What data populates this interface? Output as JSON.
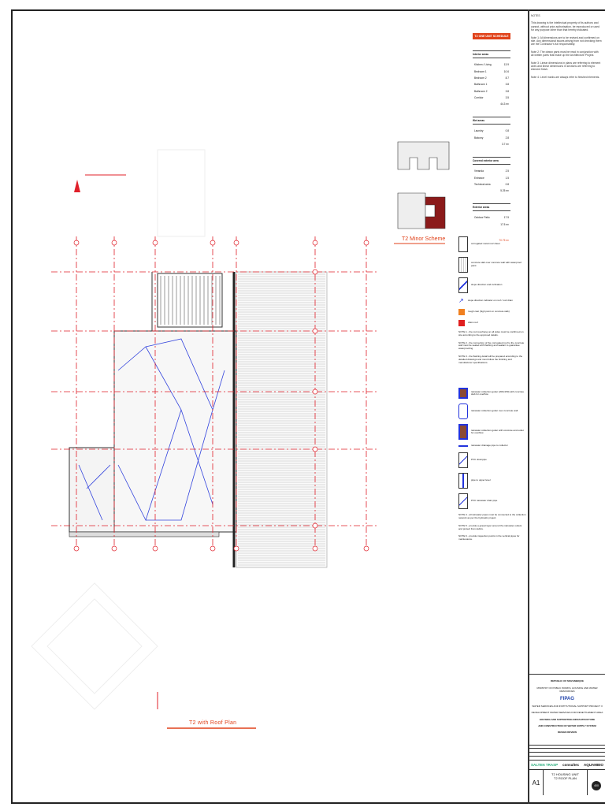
{
  "notes": {
    "heading": "NOTES",
    "items": [
      "This drawing is the intellectual property of its authors and cannot, without prior authorisation, be reproduced or used for any purpose other than that hereby indicated.",
      "Note 1: All dimensions are to be revised and confirmed on site. Any dimensional issues arising from not checking them are the Contractor's full responsibility.",
      "Note 2: The drawn parts must be read in conjunction with all written parts that make up the Architecture Project.",
      "Note 3: Linear dimensions in plans are referring to element axes and linear dimensions in sections are referring to element finish.",
      "Note 4: Level marks are always refer to finished elements."
    ]
  },
  "schedule": {
    "title": "T2 ONE UNIT SCHEDULE",
    "groups": [
      {
        "title": "Interior areas",
        "rows": [
          [
            "Kitchen / Living",
            "13.9"
          ],
          [
            "Bedroom 1",
            "10.6"
          ],
          [
            "Bedroom 2",
            "8.7"
          ],
          [
            "Bathroom 1",
            "3.8"
          ],
          [
            "Bathroom 2",
            "3.8"
          ],
          [
            "Corridor",
            "3.5"
          ]
        ],
        "total": "44.3 m²"
      },
      {
        "title": "Wet areas",
        "rows": [
          [
            "Laundry",
            "0.8"
          ],
          [
            "Balcony",
            "2.8"
          ]
        ],
        "total": "3.7 m²"
      },
      {
        "title": "Covered exterior area",
        "rows": [
          [
            "Veranda",
            "2.5"
          ],
          [
            "Entrance",
            "1.5"
          ],
          [
            "Technical area",
            "0.8"
          ]
        ],
        "total": "5.25 m²"
      },
      {
        "title": "Exterior areas",
        "rows": [
          [
            "Outdoor Patio",
            "17.5"
          ]
        ],
        "total": "17.5 m²"
      }
    ],
    "grand_total": "70.75 m²"
  },
  "minor_scheme_title": "T2 Minor Scheme",
  "plan_title": "T2 with Roof Plan",
  "legend": {
    "items": [
      "corrugated metal roof sheet",
      "concrete slab over concrete wall with waterproof paint",
      "slope direction and inclination",
      "slope direction indicator on roof / roof drain",
      "rough cast (high point on concrete slab)",
      "drain roof"
    ],
    "paras": [
      "NOTE 1 - the roof overhang on all sides must be confirmed on site according to the approved details.",
      "NOTE 2 - the connection of the corrugated roof to the concrete wall must be sealed with flashing and sealant to guarantee waterproofing.",
      "NOTE 3 - the flashing detail will be prepared according to the detailed drawings and must follow the finishing and manufacturer specifications."
    ],
    "items2": [
      "rainwater collection gutter (200x150) with concrete slab for overflow",
      "rainwater collection gutter over concrete wall",
      "rainwater collection gutter with concrete and outlet for overflow",
      "rainwater drainage pipe to collector",
      "PVC downpipe",
      "pipe to upper level",
      "PVC rainwater drain pipe"
    ],
    "paras2": [
      "NOTE 4 - all rainwater pipes must be connected to the collection network as per the hydraulic project.",
      "NOTE 5 - provide a gravel layer around the rainwater outlets and protect from debris.",
      "NOTE 6 - provide inspection points in the vertical pipes for maintenance."
    ]
  },
  "title_block": {
    "republic": "REPUBLIC OF MOZAMBIQUE",
    "ministry": "MINISTRY OF PUBLIC WORKS, HOUSING AND WATER RESOURCES",
    "agency": "FIPAG",
    "program": "WATER SERVICES AND INSTITUTIONAL SUPPORT PROJECT II",
    "project": "DEVELOPMENT WATER SERVICES FOR RESETTLEMENT AREA",
    "subject1": "HOUSING AND SUPPORTING INFRASTRUCTURE",
    "subject2": "AND CONSTRUCTION OF WATER SUPPLY SYSTEM",
    "phase": "DESIGN REVIEW",
    "firm1": "SALTEN TRASP",
    "firm2": "consultec",
    "firm3": "AQUAMBIO",
    "sheet_size": "A1",
    "drawing_title1": "T2 HOUSING UNIT",
    "drawing_title2": "T2 ROOF PLAN",
    "sheet_number": "400"
  },
  "colors": {
    "accent": "#e0421a",
    "grid": "#e0202a",
    "pipe": "#2233dd",
    "wall": "#8a3b2a"
  }
}
